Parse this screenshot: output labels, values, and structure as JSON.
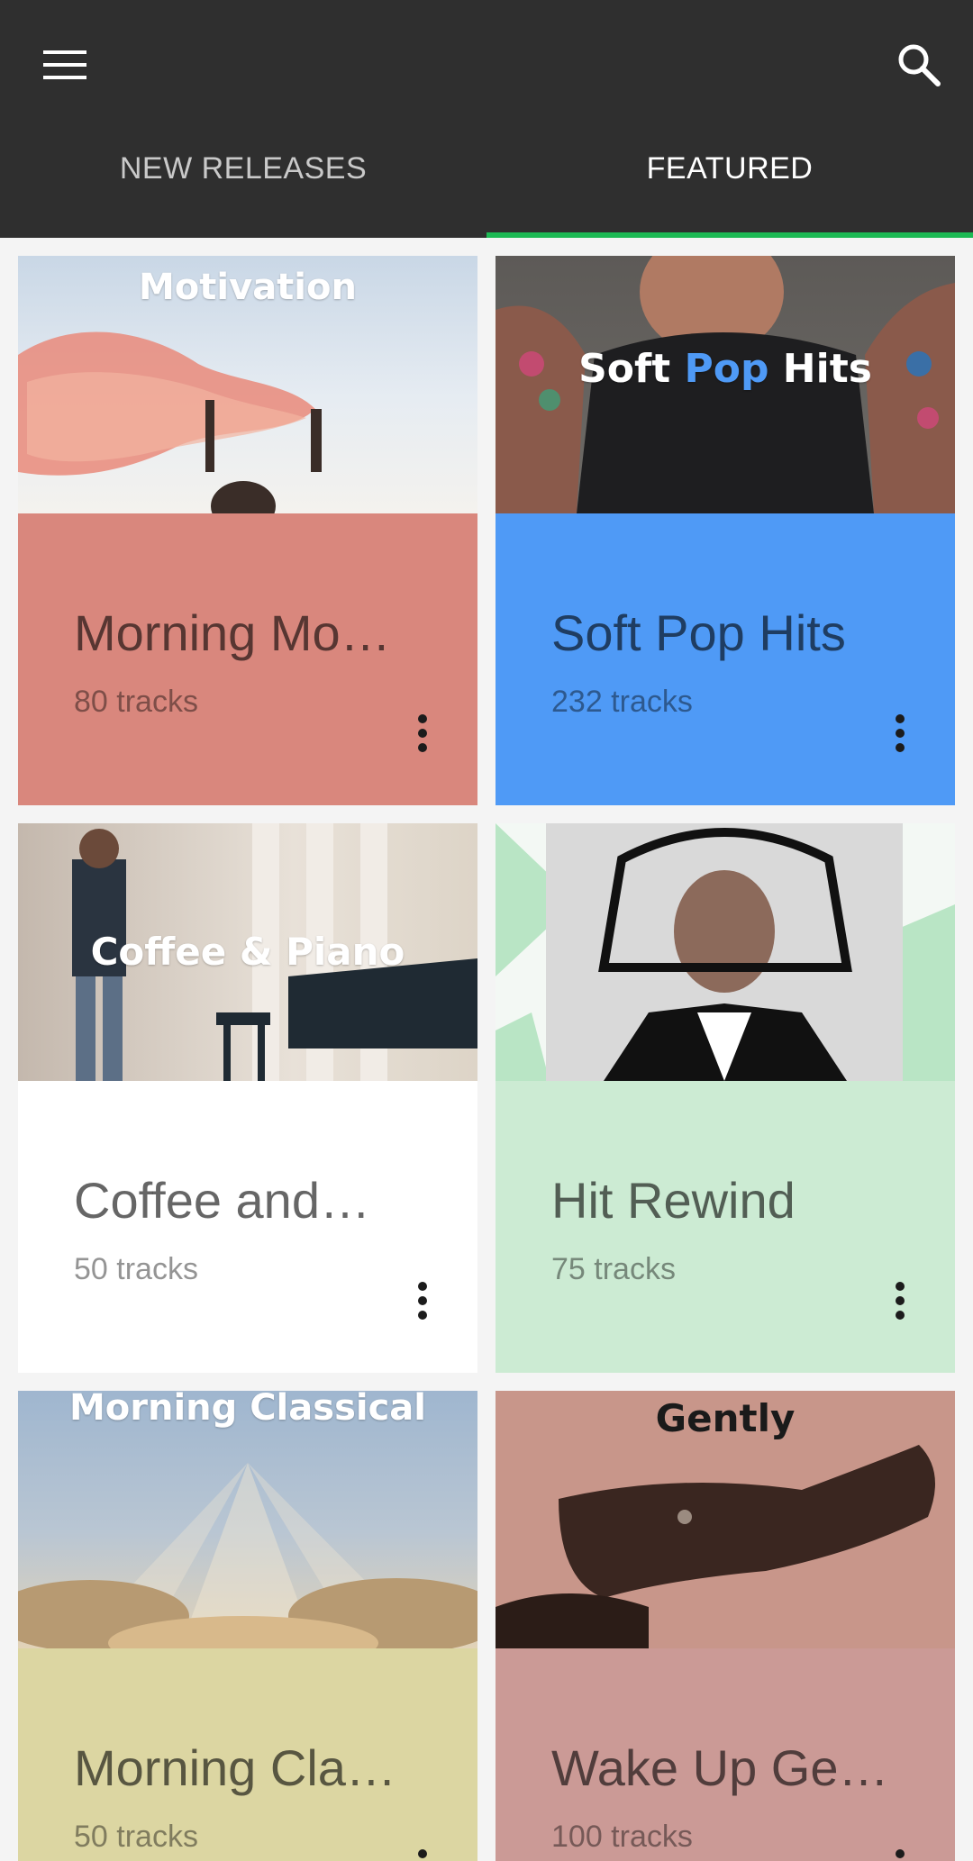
{
  "header": {
    "menu_icon": "menu-icon",
    "search_icon": "search-icon"
  },
  "tabs": [
    {
      "label": "NEW RELEASES",
      "active": false
    },
    {
      "label": "FEATURED",
      "active": true
    }
  ],
  "colors": {
    "app_bar": "#2f2f2f",
    "tab_indicator": "#1db954"
  },
  "playlists": [
    {
      "title": "Morning Mo…",
      "tracks": "80 tracks",
      "cover_text": "Motivation",
      "color": "#d9877d"
    },
    {
      "title": "Soft Pop Hits",
      "tracks": "232 tracks",
      "cover_text_a": "Soft ",
      "cover_text_b": "Pop",
      "cover_text_c": " Hits",
      "color": "#4f9af6"
    },
    {
      "title": "Coffee and…",
      "tracks": "50 tracks",
      "cover_text": "Coffee & Piano",
      "color": "#ffffff"
    },
    {
      "title": "Hit Rewind",
      "tracks": "75 tracks",
      "color": "#ccebd3"
    },
    {
      "title": "Morning Cla…",
      "tracks": "50 tracks",
      "cover_text": "Morning Classical",
      "color": "#dcd6a2"
    },
    {
      "title": "Wake Up Ge…",
      "tracks": "100 tracks",
      "cover_text": "Gently",
      "color": "#cb9a96"
    }
  ]
}
